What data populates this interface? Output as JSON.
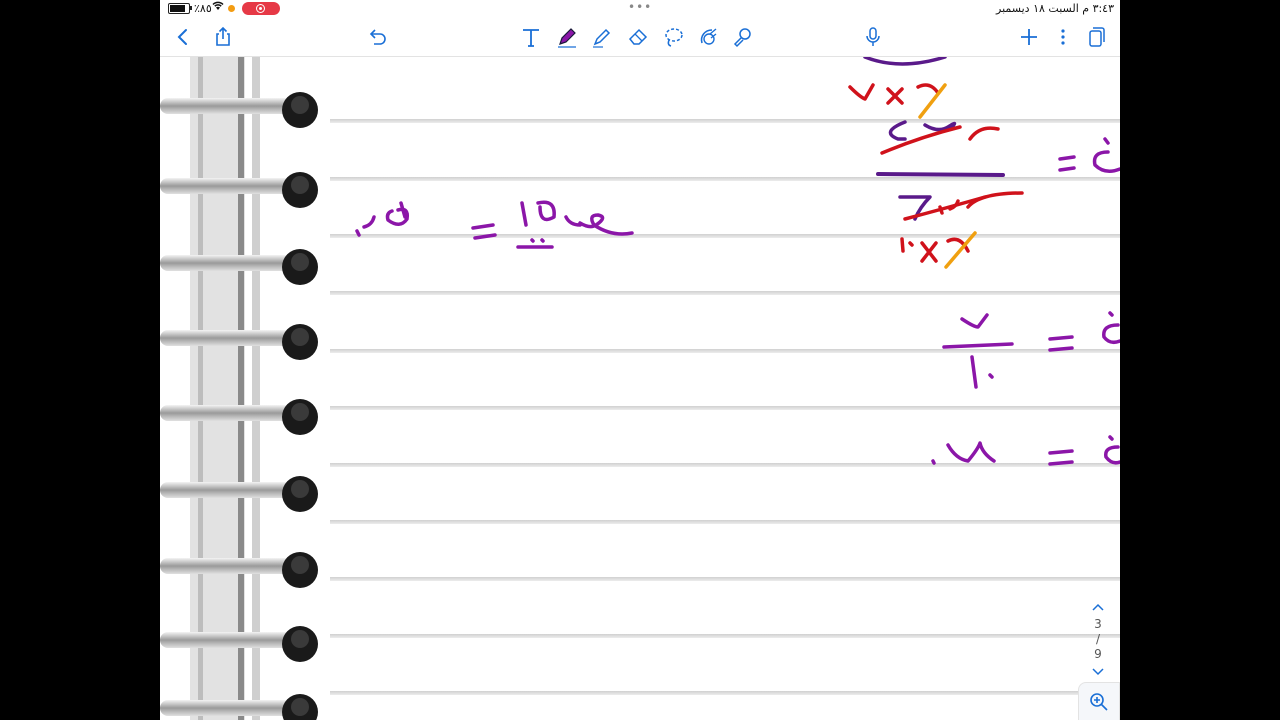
{
  "status_bar": {
    "battery_text": "٪٨٥",
    "datetime": "٣:٤٣ م   السبت ١٨ ديسمبر",
    "dots": "•••"
  },
  "toolbar": {
    "icons": [
      "back-icon",
      "share-icon",
      "undo-icon",
      "text-tool-icon",
      "pen-icon",
      "highlighter-icon",
      "eraser-icon",
      "lasso-icon",
      "shapes-icon",
      "stickers-icon",
      "microphone-icon",
      "add-page-icon",
      "more-icon",
      "pages-icon"
    ],
    "accent": "#1a6fd6"
  },
  "page_nav": {
    "current": "3",
    "separator": "/",
    "total": "9"
  },
  "colors": {
    "purple_ink": "#8b16a8",
    "red_ink": "#d0121b",
    "orange_ink": "#f0a010",
    "dark_purple_ink": "#5a1a8a"
  }
}
